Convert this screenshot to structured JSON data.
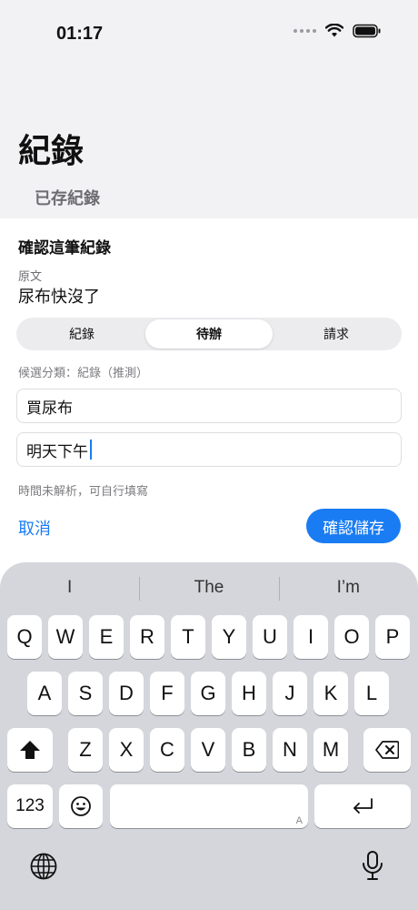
{
  "status": {
    "time": "01:17"
  },
  "header": {
    "title": "紀錄",
    "subtitle": "已存紀錄"
  },
  "card": {
    "title": "確認這筆紀錄",
    "original_label": "原文",
    "original_text": "尿布快沒了",
    "segments": [
      "紀錄",
      "待辦",
      "請求"
    ],
    "active_segment": "待辦",
    "category_hint": "候選分類：紀錄（推測）",
    "item_value": "買尿布",
    "time_value": "明天下午",
    "time_note": "時間未解析，可自行填寫",
    "cancel_label": "取消",
    "confirm_label": "確認儲存"
  },
  "keyboard": {
    "suggestions": [
      "I",
      "The",
      "I’m"
    ],
    "row1": [
      "Q",
      "W",
      "E",
      "R",
      "T",
      "Y",
      "U",
      "I",
      "O",
      "P"
    ],
    "row2": [
      "A",
      "S",
      "D",
      "F",
      "G",
      "H",
      "J",
      "K",
      "L"
    ],
    "row3": [
      "Z",
      "X",
      "C",
      "V",
      "B",
      "N",
      "M"
    ],
    "numbers_label": "123",
    "space_hint": "A"
  },
  "colors": {
    "accent": "#1a7cf2",
    "keyboard_bg": "#d4d6dc"
  }
}
